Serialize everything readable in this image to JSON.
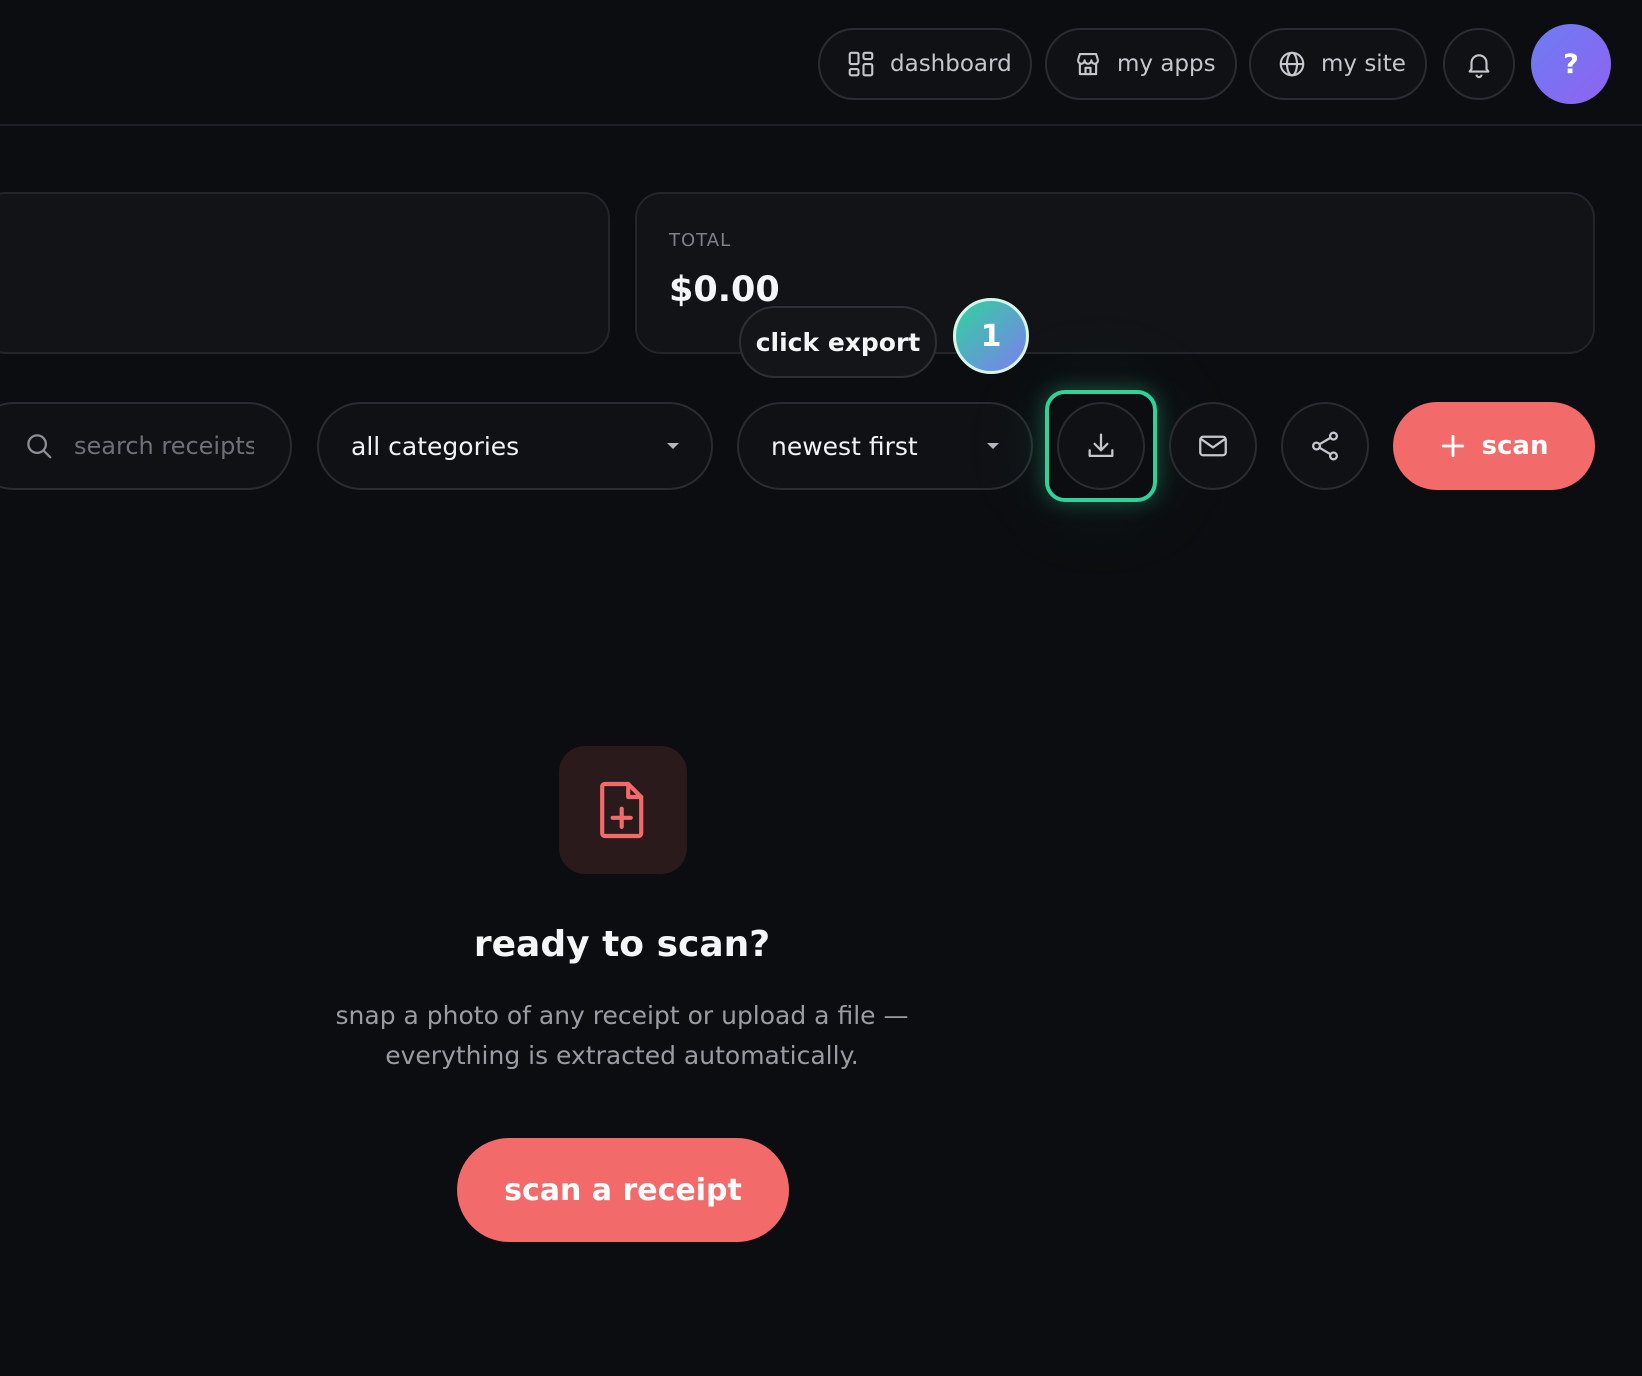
{
  "nav": {
    "dashboard_label": "dashboard",
    "my_apps_label": "my apps",
    "my_site_label": "my site",
    "avatar_label": "?",
    "icons": [
      "dashboard-icon",
      "store-icon",
      "globe-icon",
      "bell-icon"
    ]
  },
  "summary": {
    "total_label": "TOTAL",
    "total_value": "$0.00"
  },
  "toolbar": {
    "search_placeholder": "search receipts",
    "category_selected": "all categories",
    "sort_selected": "newest first",
    "icons": [
      "search-icon",
      "download-icon",
      "mail-icon",
      "share-icon",
      "plus-icon"
    ],
    "scan_label": "scan"
  },
  "tutorial": {
    "tooltip": "click export",
    "step": "1",
    "highlight_color": "#2fd39a"
  },
  "empty_state": {
    "title": "ready to scan?",
    "description": "snap a photo of any receipt or upload a file — everything is extracted automatically.",
    "button_label": "scan a receipt",
    "icon": "file-plus-icon"
  },
  "colors": {
    "background": "#0c0d10",
    "accent": "#f26a6a",
    "avatar_gradient": [
      "#6c7cf3",
      "#8f63f0"
    ]
  }
}
